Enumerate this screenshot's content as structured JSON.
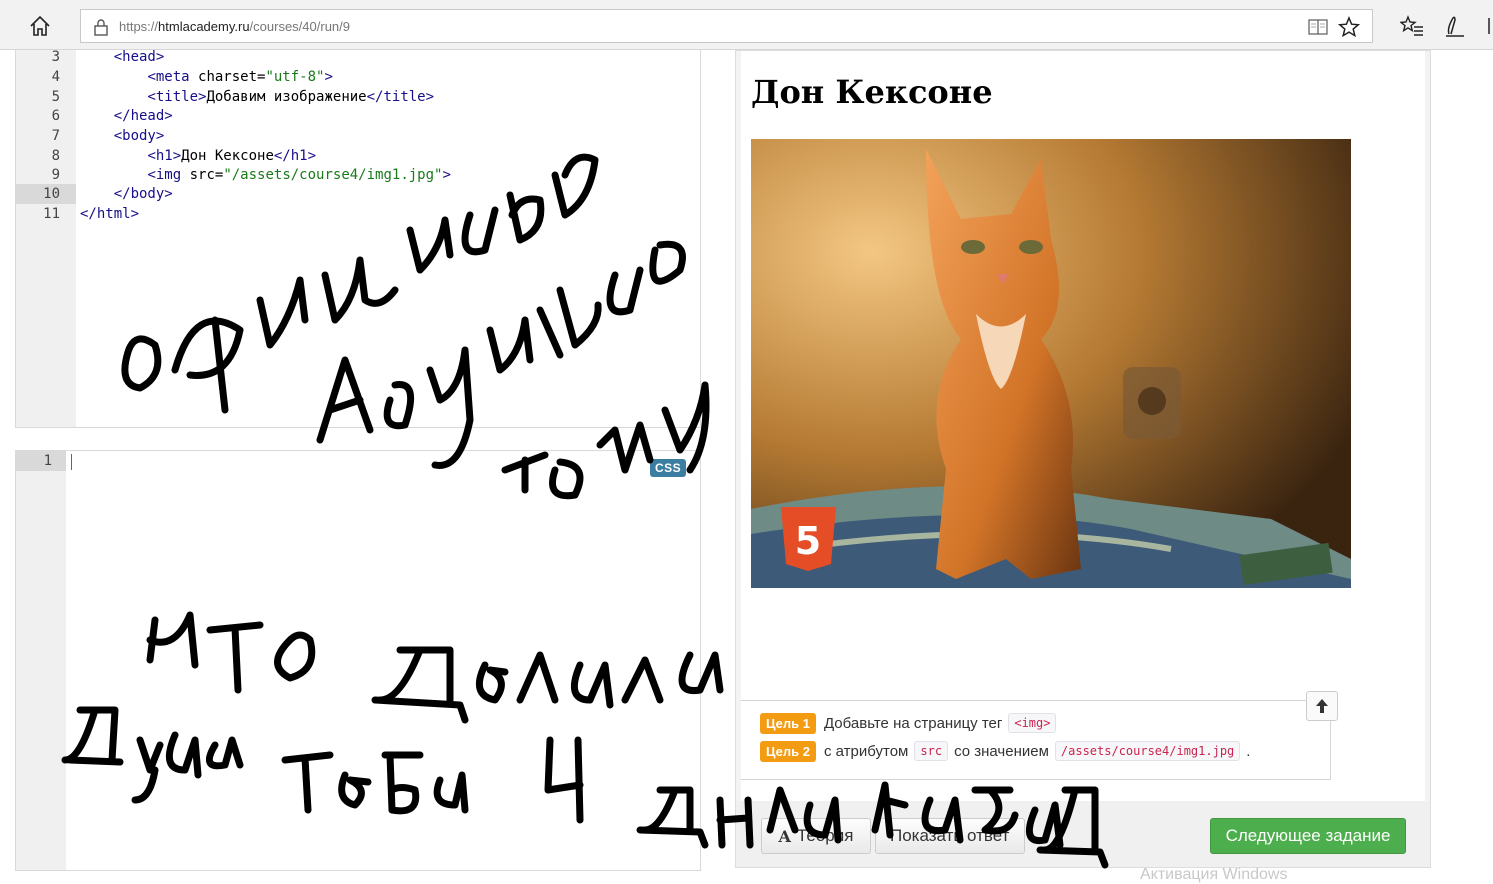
{
  "browser": {
    "url_prefix": "https://",
    "url_host": "htmlacademy.ru",
    "url_path": "/courses/40/run/9",
    "icons": [
      "home-icon",
      "lock-icon",
      "reading-view-icon",
      "favorite-star-icon",
      "favorites-list-icon",
      "pen-icon"
    ]
  },
  "html_editor": {
    "lines": [
      {
        "num": "3",
        "active": false
      },
      {
        "num": "4",
        "active": false
      },
      {
        "num": "5",
        "active": false
      },
      {
        "num": "6",
        "active": false
      },
      {
        "num": "7",
        "active": false
      },
      {
        "num": "8",
        "active": false
      },
      {
        "num": "9",
        "active": false
      },
      {
        "num": "10",
        "active": true
      },
      {
        "num": "11",
        "active": false
      }
    ],
    "code": {
      "l3": "<head>",
      "l4_tag": "<meta",
      "l4_attr": " charset=",
      "l4_val": "\"utf-8\"",
      "l4_end": ">",
      "l5_open": "<title>",
      "l5_text": "Добавим изображение",
      "l5_close": "</title>",
      "l6": "</head>",
      "l7": "<body>",
      "l8_open": "<h1>",
      "l8_text": "Дон Кексоне",
      "l8_close": "</h1>",
      "l9_tag": "<img",
      "l9_attr": " src=",
      "l9_val": "\"/assets/course4/img1.jpg\"",
      "l9_end": ">",
      "l10": "</body>",
      "l11": "</html>"
    }
  },
  "css_editor": {
    "line_num": "1",
    "badge": "CSS"
  },
  "preview": {
    "heading": "Дон Кексоне",
    "image_alt": "orange kitten photo",
    "html5_badge": "5"
  },
  "goals": [
    {
      "tag": "Цель 1",
      "text_before": "Добавьте на страницу тег",
      "code1": "<img>",
      "text_mid": "",
      "code2": "",
      "text_after": ""
    },
    {
      "tag": "Цель 2",
      "text_before": "с атрибутом",
      "code1": "src",
      "text_mid": "со значением",
      "code2": "/assets/course4/img1.jpg",
      "text_after": "."
    }
  ],
  "buttons": {
    "theory_icon": "A",
    "theory": "Теория",
    "answer": "Показать ответ",
    "next": "Следующее задание"
  },
  "watermark": "Активация Windows",
  "colors": {
    "goal_tag": "#f39c12",
    "next_button": "#4cae4c",
    "css_badge": "#3b7ea1",
    "code_tag": "#170e8a",
    "code_string": "#1a7a1a"
  }
}
